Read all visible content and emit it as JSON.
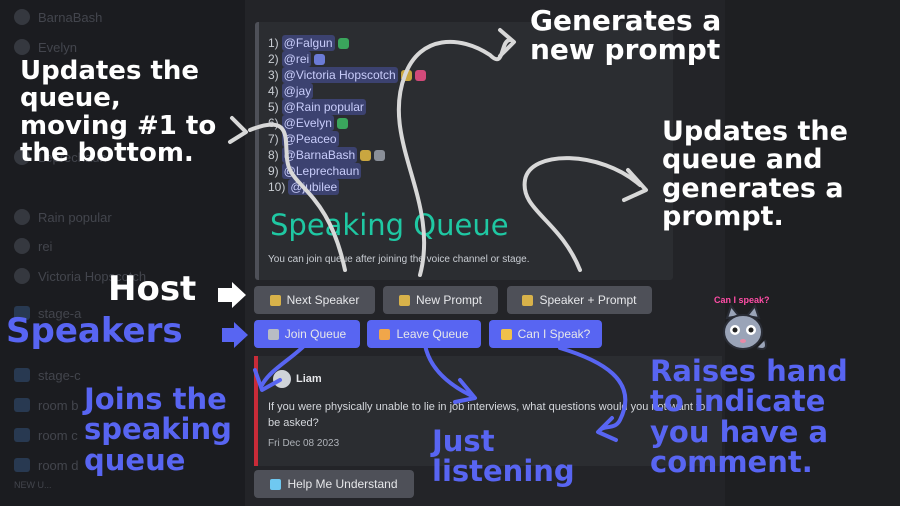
{
  "sidebar": {
    "items": [
      "BarnaBash",
      "Evelyn",
      "Leprechaun",
      "Rain popular",
      "rei",
      "Victoria Hopscotch",
      "stage-a",
      "stage-c",
      "room b",
      "room c",
      "room d",
      "NEW U..."
    ]
  },
  "queue": {
    "entries": [
      {
        "num": "1)",
        "name": "@Falgun"
      },
      {
        "num": "2)",
        "name": "@rei"
      },
      {
        "num": "3)",
        "name": "@Victoria Hopscotch"
      },
      {
        "num": "4)",
        "name": "@jay"
      },
      {
        "num": "5)",
        "name": "@Rain popular"
      },
      {
        "num": "6)",
        "name": "@Evelyn"
      },
      {
        "num": "7)",
        "name": "@Peaceo"
      },
      {
        "num": "8)",
        "name": "@BarnaBash"
      },
      {
        "num": "9)",
        "name": "@Leprechaun"
      },
      {
        "num": "10)",
        "name": "@jubilee"
      }
    ],
    "title": "Speaking Queue",
    "hint": "You can join queue after joining the voice channel or stage."
  },
  "buttons": {
    "next_speaker": "Next Speaker",
    "new_prompt": "New Prompt",
    "speaker_prompt": "Speaker + Prompt",
    "join_queue": "Join Queue",
    "leave_queue": "Leave Queue",
    "can_i_speak": "Can I Speak?",
    "help": "Help Me Understand"
  },
  "reply": {
    "author": "Liam",
    "text": "If you were physically unable to lie in job interviews, what questions would you not want to be asked?",
    "date": "Fri Dec 08 2023"
  },
  "annotations": {
    "updates_queue": [
      "Updates the",
      "queue,",
      "moving #1 to",
      "the bottom."
    ],
    "generates": [
      "Generates a",
      "new prompt"
    ],
    "updates_and_generates": [
      "Updates the",
      "queue and",
      "generates a",
      "prompt."
    ],
    "host": "Host",
    "speakers": "Speakers",
    "joins": [
      "Joins the",
      "speaking",
      "queue"
    ],
    "just_listening": [
      "Just",
      "listening"
    ],
    "raises_hand": [
      "Raises hand",
      "to indicate",
      "you have a",
      "comment."
    ],
    "can_i_speak_sticker": "Can I speak?"
  },
  "colors": {
    "accent_blue": "#5865f2",
    "title_teal": "#1fc8a3",
    "reply_bar": "#c92b38",
    "button_gray": "#4e5058"
  }
}
